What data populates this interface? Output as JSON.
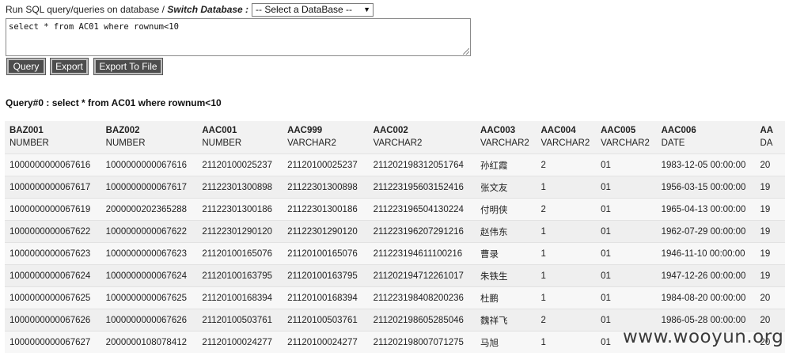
{
  "toolbar": {
    "prefix": "Run SQL query/queries on database / ",
    "switch_label": "Switch Database :",
    "db_select_value": "-- Select a DataBase --"
  },
  "query_text": "select * from AC01 where rownum<10",
  "buttons": {
    "query": "Query",
    "export": "Export",
    "export_to_file": "Export To File"
  },
  "result_title": "Query#0 : select * from AC01 where rownum<10",
  "columns": [
    {
      "name": "BAZ001",
      "type": "NUMBER"
    },
    {
      "name": "BAZ002",
      "type": "NUMBER"
    },
    {
      "name": "AAC001",
      "type": "NUMBER"
    },
    {
      "name": "AAC999",
      "type": "VARCHAR2"
    },
    {
      "name": "AAC002",
      "type": "VARCHAR2"
    },
    {
      "name": "AAC003",
      "type": "VARCHAR2"
    },
    {
      "name": "AAC004",
      "type": "VARCHAR2"
    },
    {
      "name": "AAC005",
      "type": "VARCHAR2"
    },
    {
      "name": "AAC006",
      "type": "DATE"
    },
    {
      "name": "AA",
      "type": "DA"
    }
  ],
  "rows": [
    [
      "1000000000067616",
      "1000000000067616",
      "21120100025237",
      "21120100025237",
      "211202198312051764",
      "孙红霞",
      "2",
      "01",
      "1983-12-05 00:00:00",
      "20"
    ],
    [
      "1000000000067617",
      "1000000000067617",
      "21122301300898",
      "21122301300898",
      "211223195603152416",
      "张文友",
      "1",
      "01",
      "1956-03-15 00:00:00",
      "19"
    ],
    [
      "1000000000067619",
      "2000000202365288",
      "21122301300186",
      "21122301300186",
      "211223196504130224",
      "付明侠",
      "2",
      "01",
      "1965-04-13 00:00:00",
      "19"
    ],
    [
      "1000000000067622",
      "1000000000067622",
      "21122301290120",
      "21122301290120",
      "211223196207291216",
      "赵伟东",
      "1",
      "01",
      "1962-07-29 00:00:00",
      "19"
    ],
    [
      "1000000000067623",
      "1000000000067623",
      "21120100165076",
      "21120100165076",
      "211223194611100216",
      "曹录",
      "1",
      "01",
      "1946-11-10 00:00:00",
      "19"
    ],
    [
      "1000000000067624",
      "1000000000067624",
      "21120100163795",
      "21120100163795",
      "211202194712261017",
      "朱铁生",
      "1",
      "01",
      "1947-12-26 00:00:00",
      "19"
    ],
    [
      "1000000000067625",
      "1000000000067625",
      "21120100168394",
      "21120100168394",
      "211223198408200236",
      "杜鹏",
      "1",
      "01",
      "1984-08-20 00:00:00",
      "20"
    ],
    [
      "1000000000067626",
      "1000000000067626",
      "21120100503761",
      "21120100503761",
      "211202198605285046",
      "魏祥飞",
      "2",
      "01",
      "1986-05-28 00:00:00",
      "20"
    ],
    [
      "1000000000067627",
      "2000000108078412",
      "21120100024277",
      "21120100024277",
      "211202198007071275",
      "马旭",
      "1",
      "01",
      "",
      "20"
    ]
  ],
  "watermark": "www.wooyun.org"
}
